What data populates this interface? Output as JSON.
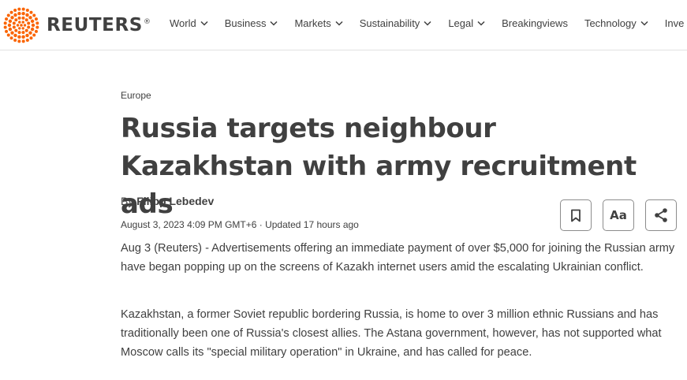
{
  "header": {
    "logo_text": "REUTERS",
    "logo_mark": "®",
    "nav": [
      {
        "label": "World",
        "has_dropdown": true
      },
      {
        "label": "Business",
        "has_dropdown": true
      },
      {
        "label": "Markets",
        "has_dropdown": true
      },
      {
        "label": "Sustainability",
        "has_dropdown": true
      },
      {
        "label": "Legal",
        "has_dropdown": true
      },
      {
        "label": "Breakingviews",
        "has_dropdown": false
      },
      {
        "label": "Technology",
        "has_dropdown": true
      },
      {
        "label": "Inve",
        "has_dropdown": false
      }
    ]
  },
  "article": {
    "section": "Europe",
    "headline": "Russia targets neighbour Kazakhstan with army recruitment ads",
    "byline_prefix": "By",
    "author": "Filipp Lebedev",
    "dateline": "August 3, 2023 4:09 PM GMT+6 · Updated 17 hours ago",
    "paragraphs": [
      "Aug 3 (Reuters) - Advertisements offering an immediate payment of over $5,000 for joining the Russian army have began popping up on the screens of Kazakh internet users amid the escalating Ukrainian conflict.",
      "Kazakhstan, a former Soviet republic bordering Russia, is home to over 3 million ethnic Russians and has traditionally been one of Russia's closest allies. The Astana government, however, has not supported what Moscow calls its \"special military operation\" in Ukraine, and has called for peace."
    ]
  },
  "tools": {
    "bookmark_icon": "bookmark-icon",
    "text_size_label": "Aa",
    "share_icon": "share-icon"
  },
  "colors": {
    "logo_orange": "#fa6400",
    "text": "#404040",
    "divider": "#e2e2e2",
    "button_border": "#8c8c8c"
  }
}
